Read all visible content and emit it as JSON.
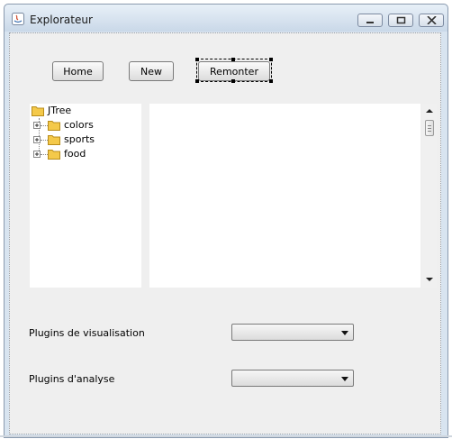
{
  "window": {
    "title": "Explorateur",
    "controls": [
      "minimize-icon",
      "maximize-icon",
      "close-icon"
    ]
  },
  "toolbar": {
    "home_label": "Home",
    "new_label": "New",
    "remonter_label": "Remonter"
  },
  "tree": {
    "root": {
      "label": "JTree",
      "icon": "folder-icon"
    },
    "children": [
      {
        "label": "colors",
        "icon": "folder-icon",
        "expander": "plus"
      },
      {
        "label": "sports",
        "icon": "folder-icon",
        "expander": "plus"
      },
      {
        "label": "food",
        "icon": "folder-icon",
        "expander": "plus"
      }
    ]
  },
  "plugins": {
    "visualisation_label": "Plugins de visualisation",
    "visualisation_value": "",
    "analyse_label": "Plugins d'analyse",
    "analyse_value": ""
  }
}
